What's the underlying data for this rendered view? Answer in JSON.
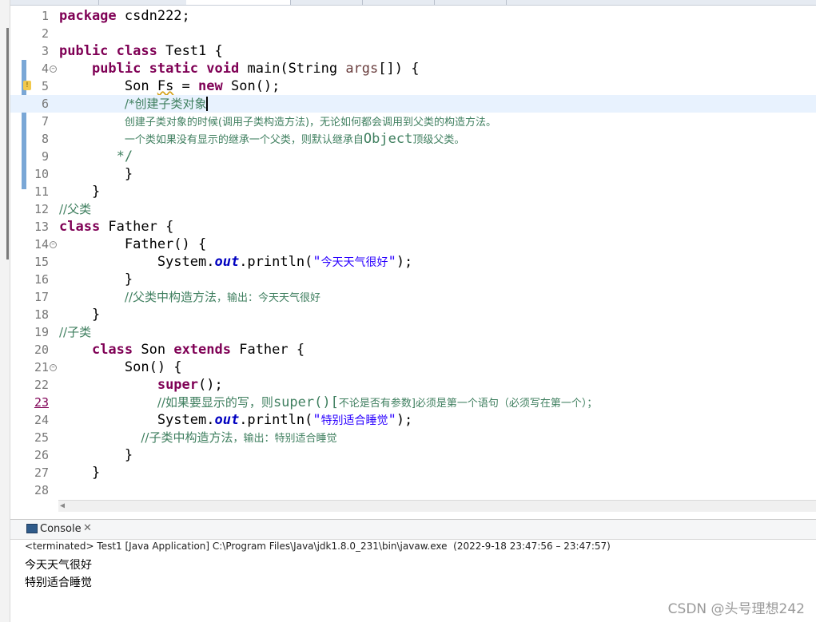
{
  "editor": {
    "lines": [
      {
        "num": "1",
        "segments": [
          {
            "t": "package",
            "c": "kw"
          },
          {
            "t": " csdn222;",
            "c": ""
          }
        ]
      },
      {
        "num": "2",
        "segments": []
      },
      {
        "num": "3",
        "segments": [
          {
            "t": "public",
            "c": "kw"
          },
          {
            "t": " ",
            "c": ""
          },
          {
            "t": "class",
            "c": "kw"
          },
          {
            "t": " Test1 {",
            "c": ""
          }
        ]
      },
      {
        "num": "4",
        "fold": true,
        "segments": [
          {
            "t": "    ",
            "c": ""
          },
          {
            "t": "public",
            "c": "kw"
          },
          {
            "t": " ",
            "c": ""
          },
          {
            "t": "static",
            "c": "kw"
          },
          {
            "t": " ",
            "c": ""
          },
          {
            "t": "void",
            "c": "kw"
          },
          {
            "t": " main(String ",
            "c": ""
          },
          {
            "t": "args",
            "c": "var"
          },
          {
            "t": "[]) {",
            "c": ""
          }
        ]
      },
      {
        "num": "5",
        "warn": true,
        "segments": [
          {
            "t": "        Son ",
            "c": ""
          },
          {
            "t": "Fs",
            "c": "squiggle"
          },
          {
            "t": " = ",
            "c": ""
          },
          {
            "t": "new",
            "c": "kw"
          },
          {
            "t": " Son();",
            "c": ""
          }
        ]
      },
      {
        "num": "6",
        "current": true,
        "segments": [
          {
            "t": "        ",
            "c": ""
          },
          {
            "t": "/*创建子类对象",
            "c": "cm-cn caret"
          }
        ]
      },
      {
        "num": "7",
        "segments": [
          {
            "t": "        ",
            "c": ""
          },
          {
            "t": "创建子类对象的时候(调用子类构造方法)，无论如何都会调用到父类的构造方法。",
            "c": "cm-small"
          }
        ]
      },
      {
        "num": "8",
        "segments": [
          {
            "t": "        ",
            "c": ""
          },
          {
            "t": "一个类如果没有显示的继承一个父类，则默认继承自",
            "c": "cm-small"
          },
          {
            "t": "Object",
            "c": "cm"
          },
          {
            "t": "顶级父类。",
            "c": "cm-small"
          }
        ]
      },
      {
        "num": "9",
        "segments": [
          {
            "t": "       ",
            "c": ""
          },
          {
            "t": "*/",
            "c": "cm"
          }
        ]
      },
      {
        "num": "10",
        "segments": [
          {
            "t": "        }",
            "c": ""
          }
        ]
      },
      {
        "num": "11",
        "segments": [
          {
            "t": "    }",
            "c": ""
          }
        ]
      },
      {
        "num": "12",
        "segments": [
          {
            "t": "//父类",
            "c": "cm-cn"
          }
        ]
      },
      {
        "num": "13",
        "segments": [
          {
            "t": "class",
            "c": "kw"
          },
          {
            "t": " Father {",
            "c": ""
          }
        ]
      },
      {
        "num": "14",
        "fold": true,
        "segments": [
          {
            "t": "        Father() {",
            "c": ""
          }
        ]
      },
      {
        "num": "15",
        "segments": [
          {
            "t": "            System.",
            "c": ""
          },
          {
            "t": "out",
            "c": "fld"
          },
          {
            "t": ".println(",
            "c": ""
          },
          {
            "t": "\"",
            "c": "str"
          },
          {
            "t": "今天天气很好",
            "c": "str-cn"
          },
          {
            "t": "\"",
            "c": "str"
          },
          {
            "t": ");",
            "c": ""
          }
        ]
      },
      {
        "num": "16",
        "segments": [
          {
            "t": "        }",
            "c": ""
          }
        ]
      },
      {
        "num": "17",
        "segments": [
          {
            "t": "        ",
            "c": ""
          },
          {
            "t": "//父类中构造方法",
            "c": "cm-cn"
          },
          {
            "t": "，输出：今天天气很好",
            "c": "cm-small"
          }
        ]
      },
      {
        "num": "18",
        "segments": [
          {
            "t": "    }",
            "c": ""
          }
        ]
      },
      {
        "num": "19",
        "segments": [
          {
            "t": "//子类",
            "c": "cm-cn"
          }
        ]
      },
      {
        "num": "20",
        "segments": [
          {
            "t": "    ",
            "c": ""
          },
          {
            "t": "class",
            "c": "kw"
          },
          {
            "t": " Son ",
            "c": ""
          },
          {
            "t": "extends",
            "c": "kw"
          },
          {
            "t": " Father {",
            "c": ""
          }
        ]
      },
      {
        "num": "21",
        "fold": true,
        "segments": [
          {
            "t": "        Son() {",
            "c": ""
          }
        ]
      },
      {
        "num": "22",
        "segments": [
          {
            "t": "            ",
            "c": ""
          },
          {
            "t": "super",
            "c": "kw"
          },
          {
            "t": "();",
            "c": ""
          }
        ]
      },
      {
        "num": "23",
        "marked": true,
        "segments": [
          {
            "t": "            ",
            "c": ""
          },
          {
            "t": "//如果要显示的写，则",
            "c": "cm-cn"
          },
          {
            "t": "super()[",
            "c": "cm"
          },
          {
            "t": "不论是否有参数]必须是第一个语句（必须写在第一个）；",
            "c": "cm-small"
          }
        ]
      },
      {
        "num": "24",
        "segments": [
          {
            "t": "            System.",
            "c": ""
          },
          {
            "t": "out",
            "c": "fld"
          },
          {
            "t": ".println(",
            "c": ""
          },
          {
            "t": "\"",
            "c": "str"
          },
          {
            "t": "特别适合睡觉",
            "c": "str-cn"
          },
          {
            "t": "\"",
            "c": "str"
          },
          {
            "t": ");",
            "c": ""
          }
        ]
      },
      {
        "num": "25",
        "segments": [
          {
            "t": "          ",
            "c": ""
          },
          {
            "t": "//子类中构造方法",
            "c": "cm-cn"
          },
          {
            "t": "，输出：特别适合睡觉",
            "c": "cm-small"
          }
        ]
      },
      {
        "num": "26",
        "segments": [
          {
            "t": "        }",
            "c": ""
          }
        ]
      },
      {
        "num": "27",
        "segments": [
          {
            "t": "    }",
            "c": ""
          }
        ]
      },
      {
        "num": "28",
        "segments": []
      }
    ]
  },
  "console": {
    "tab_label": "Console",
    "close_glyph": "✕",
    "status": "<terminated> Test1 [Java Application] C:\\Program Files\\Java\\jdk1.8.0_231\\bin\\javaw.exe  (2022-9-18 23:47:56 – 23:47:57)",
    "output": [
      "今天天气很好",
      "特别适合睡觉"
    ]
  },
  "watermark": "CSDN @头号理想242",
  "colors": {
    "keyword": "#7f0055",
    "comment": "#3f7f5f",
    "string": "#2a00ff",
    "field": "#0000c0",
    "current_line": "#e8f2fe"
  }
}
